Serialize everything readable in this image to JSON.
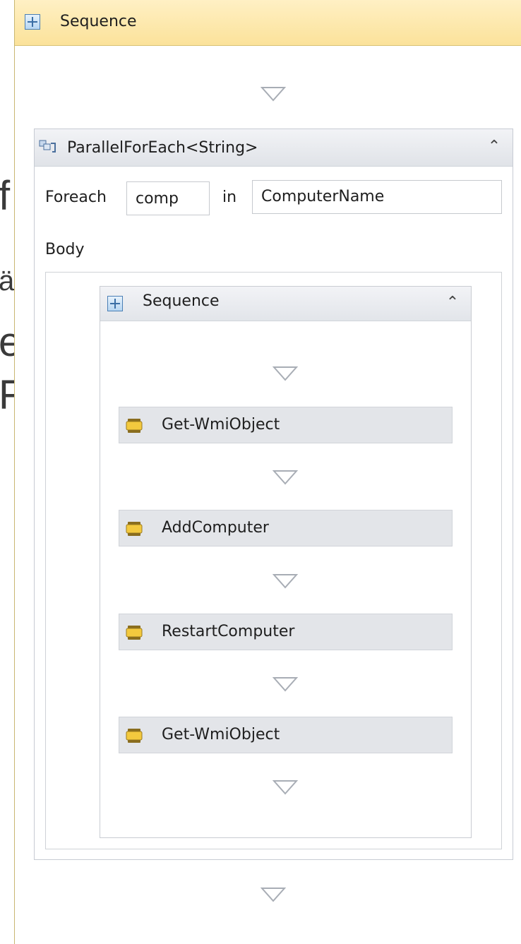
{
  "background_fragment": [
    "f",
    "ä",
    "e",
    "F"
  ],
  "outer_sequence": {
    "title": "Sequence",
    "icon": "sequence-icon"
  },
  "parallel_foreach": {
    "title": "ParallelForEach<String>",
    "icon": "parallel-foreach-icon",
    "collapse_icon": "double-chevron-up-icon",
    "foreach_label": "Foreach",
    "variable_value": "comp",
    "in_label": "in",
    "collection_value": "ComputerName",
    "body_label": "Body"
  },
  "inner_sequence": {
    "title": "Sequence",
    "icon": "sequence-icon",
    "collapse_icon": "double-chevron-up-icon",
    "activities": [
      {
        "label": "Get-WmiObject",
        "icon": "activity-icon"
      },
      {
        "label": "AddComputer",
        "icon": "activity-icon"
      },
      {
        "label": "RestartComputer",
        "icon": "activity-icon"
      },
      {
        "label": "Get-WmiObject",
        "icon": "activity-icon"
      }
    ]
  },
  "colors": {
    "outer_header": "#fbe29a",
    "container_header": "#e0e3e8",
    "activity_bg": "#e3e5e9",
    "drop_arrow": "#a8adb5"
  }
}
